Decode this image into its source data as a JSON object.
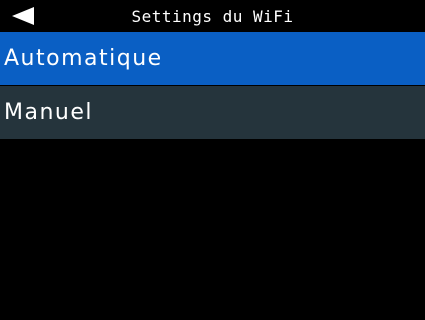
{
  "header": {
    "title": "Settings du WiFi",
    "back_icon": "back-arrow-icon"
  },
  "menu": {
    "items": [
      {
        "label": "Automatique",
        "state": "selected"
      },
      {
        "label": "Manuel",
        "state": "normal"
      }
    ]
  },
  "colors": {
    "background": "#000000",
    "selected": "#0a5fc4",
    "item": "#25343c",
    "text": "#ffffff"
  }
}
